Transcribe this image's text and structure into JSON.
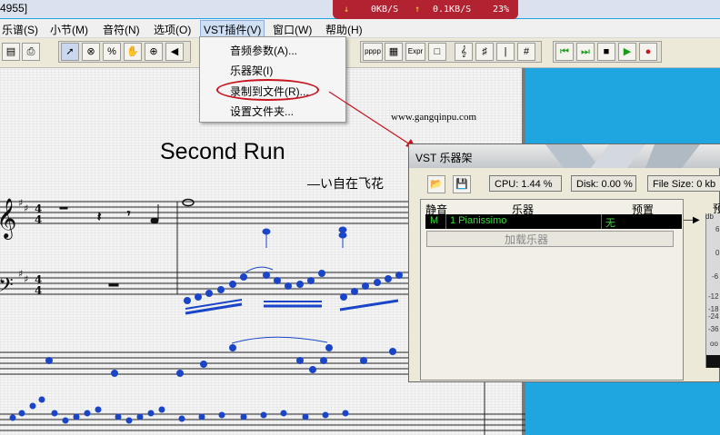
{
  "window": {
    "title_fragment": "4955]"
  },
  "netbar": {
    "down_speed": "0KB/S",
    "up_speed": "0.1KB/S",
    "percent": "23%"
  },
  "menubar": {
    "items": [
      "乐谱(S)",
      "小节(M)",
      "音符(N)",
      "选项(O)",
      "VST插件(V)",
      "窗口(W)",
      "帮助(H)"
    ]
  },
  "toolbar": {
    "text_buttons": [
      "pppp",
      "Expr"
    ]
  },
  "vst_menu": {
    "items": [
      "音频参数(A)...",
      "乐器架(I)",
      "录制到文件(R)...",
      "设置文件夹..."
    ]
  },
  "score": {
    "website": "www.gangqinpu.com",
    "title": "Second Run",
    "composer": "—い自在飞花"
  },
  "vst_window": {
    "title": "VST 乐器架",
    "cpu": "CPU: 1.44 %",
    "disk": "Disk: 0.00 %",
    "file_size": "File Size: 0 kb",
    "columns": {
      "mute": "静音",
      "instrument": "乐器",
      "preset": "预置",
      "extra": "预"
    },
    "rows": [
      {
        "mute": "M",
        "instrument": "1  Pianissimo",
        "preset": "无"
      }
    ],
    "add_instrument": "加载乐器",
    "meter_labels": [
      "db",
      "6",
      "0",
      "-6",
      "-12",
      "-18",
      "-24",
      "-36",
      "oo"
    ]
  },
  "colors": {
    "accent_red": "#c8141e",
    "netbar_bg": "#b22230",
    "desktop_blue": "#1fa6e0",
    "meter_green": "#3cdc3c"
  }
}
